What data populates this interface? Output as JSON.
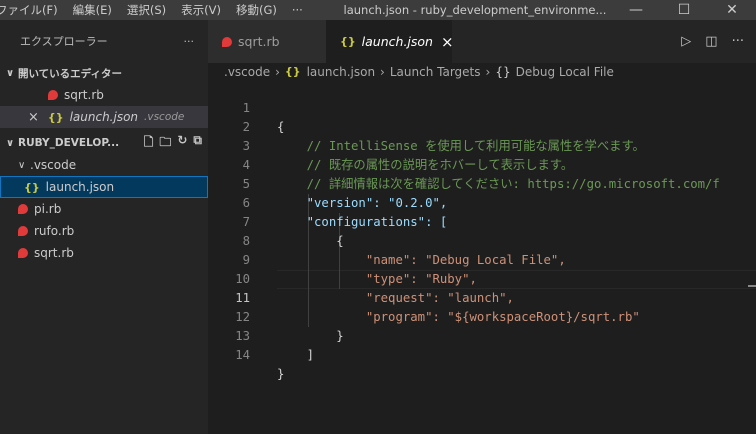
{
  "menu": [
    "ファイル(F)",
    "編集(E)",
    "選択(S)",
    "表示(V)",
    "移動(G)",
    "···"
  ],
  "window_title": "launch.json - ruby_development_environme...",
  "window_buttons": [
    "—",
    "☐",
    "✕"
  ],
  "sidebar": {
    "title": "エクスプローラー",
    "more": "···",
    "open_editors": "開いているエディター",
    "open_items": [
      {
        "name": "sqrt.rb",
        "type": "ruby"
      },
      {
        "name": "launch.json",
        "type": "json",
        "detail": ".vscode",
        "close": "×"
      }
    ],
    "folder": "RUBY_DEVELOP...",
    "tree": [
      {
        "name": ".vscode",
        "type": "folder"
      },
      {
        "name": "launch.json",
        "type": "json"
      },
      {
        "name": "pi.rb",
        "type": "ruby"
      },
      {
        "name": "rufo.rb",
        "type": "ruby"
      },
      {
        "name": "sqrt.rb",
        "type": "ruby"
      }
    ]
  },
  "tabs": [
    {
      "label": "sqrt.rb"
    },
    {
      "label": "launch.json",
      "close": "×"
    }
  ],
  "breadcrumb": [
    ".vscode",
    "launch.json",
    "Launch Targets",
    "Debug Local File"
  ],
  "editor": {
    "line_numbers": [
      "1",
      "2",
      "3",
      "4",
      "5",
      "6",
      "7",
      "8",
      "9",
      "10",
      "11",
      "12",
      "13",
      "14"
    ],
    "current_line": "11",
    "lines": [
      "{",
      "    // IntelliSense を使用して利用可能な属性を学べます。",
      "    // 既存の属性の説明をホバーして表示します。",
      "    // 詳細情報は次を確認してください: https://go.microsoft.com/f",
      "    \"version\": \"0.2.0\",",
      "    \"configurations\": [",
      "        {",
      "            \"name\": \"Debug Local File\",",
      "            \"type\": \"Ruby\",",
      "            \"request\": \"launch\",",
      "            \"program\": \"${workspaceRoot}/sqrt.rb\"",
      "        }",
      "    ]",
      "}"
    ]
  }
}
